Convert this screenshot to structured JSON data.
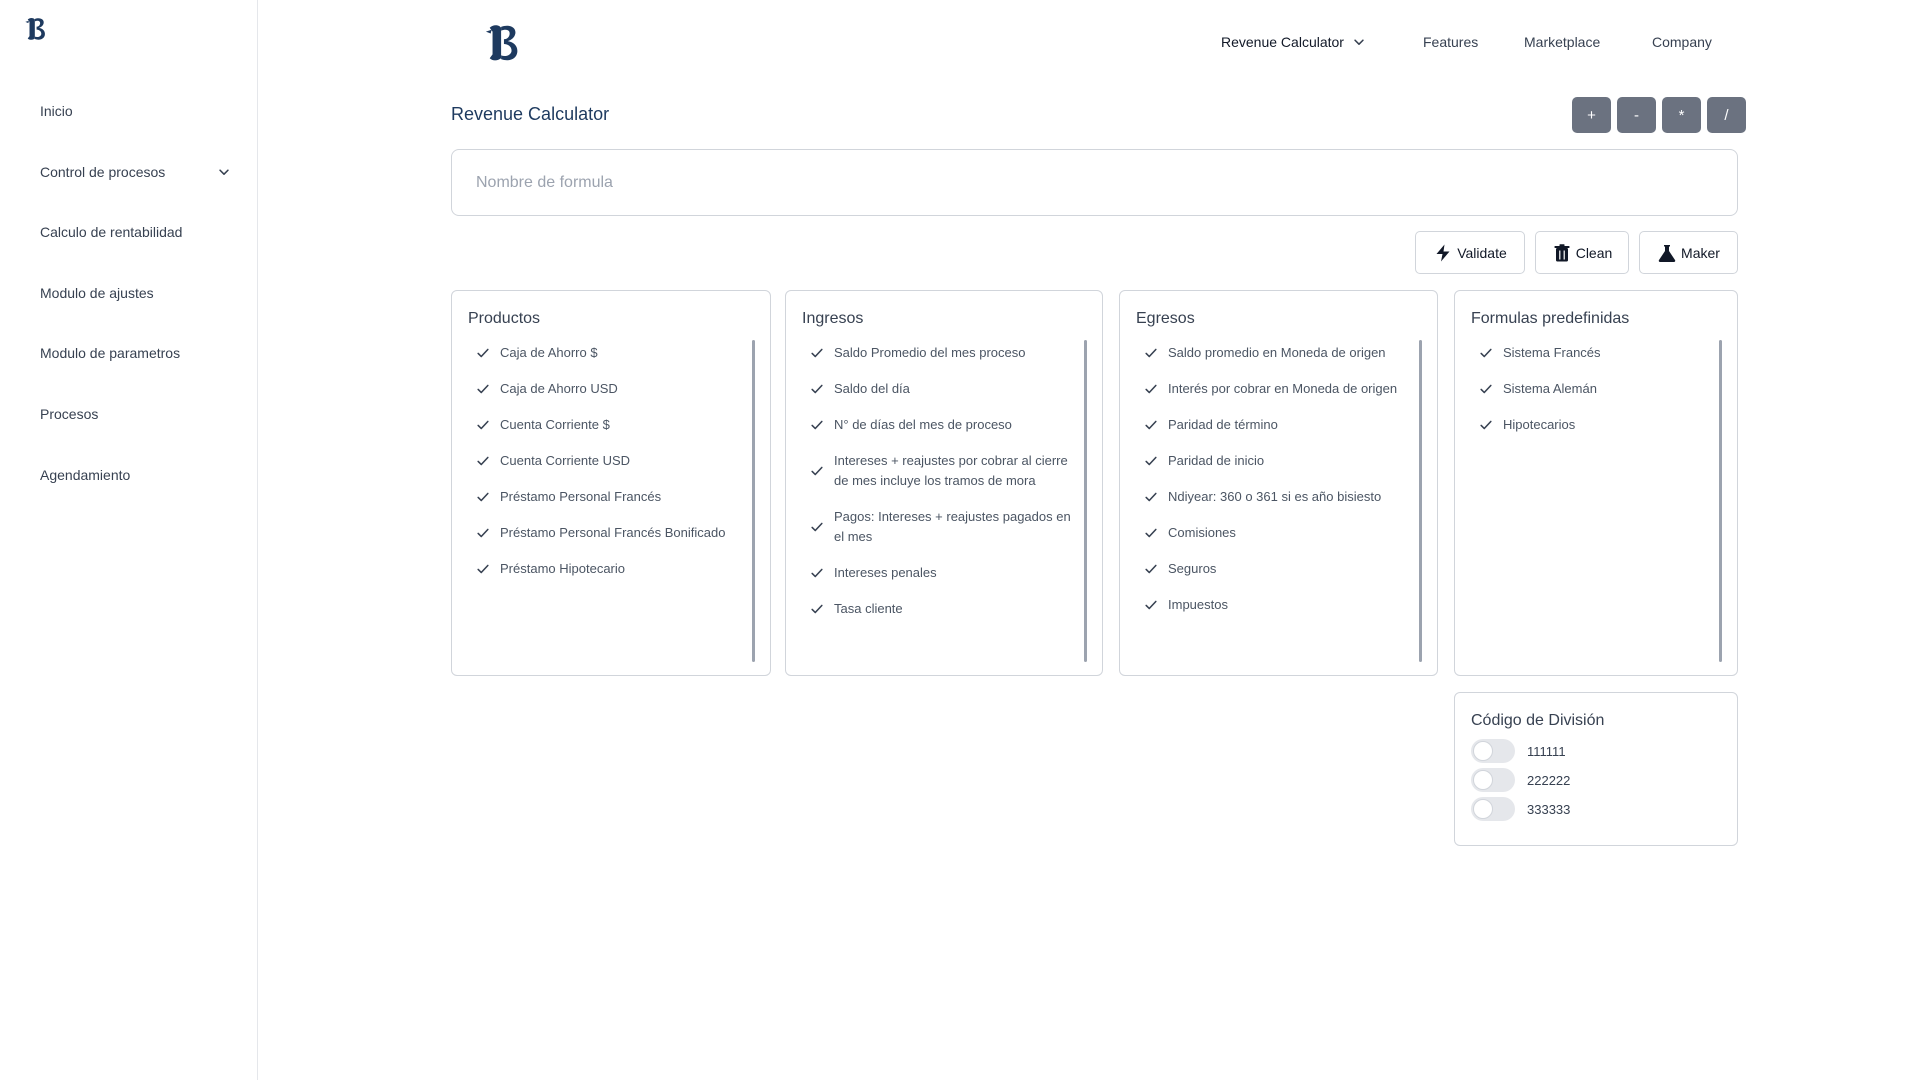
{
  "sidebar": {
    "logo_icon": "gothic-b-logo",
    "items": [
      {
        "label": "Inicio"
      },
      {
        "label": "Control de procesos",
        "icon": "chevron-down-icon"
      },
      {
        "label": "Calculo de rentabilidad"
      },
      {
        "label": "Modulo de ajustes"
      },
      {
        "label": "Modulo de parametros"
      },
      {
        "label": "Procesos"
      },
      {
        "label": "Agendamiento"
      }
    ]
  },
  "topnav": {
    "logo_icon": "gothic-b-logo",
    "items": [
      {
        "label": "Revenue Calculator",
        "icon": "chevron-down-icon"
      },
      {
        "label": "Features"
      },
      {
        "label": "Marketplace"
      },
      {
        "label": "Company"
      }
    ]
  },
  "page": {
    "title": "Revenue Calculator",
    "operators": [
      "+",
      "-",
      "*",
      "/"
    ],
    "formula_placeholder": "Nombre de formula",
    "actions": {
      "validate": "Validate",
      "clean": "Clean",
      "maker": "Maker"
    }
  },
  "panels": {
    "productos": {
      "title": "Productos",
      "items": [
        "Caja de Ahorro $",
        "Caja de Ahorro USD",
        "Cuenta Corriente $",
        "Cuenta Corriente USD",
        "Préstamo Personal Francés",
        "Préstamo Personal Francés Bonificado",
        "Préstamo Hipotecario"
      ]
    },
    "ingresos": {
      "title": "Ingresos",
      "items": [
        "Saldo Promedio del mes proceso",
        "Saldo del día",
        "N° de días del mes de proceso",
        "Intereses + reajustes por cobrar al cierre de mes incluye los tramos de mora",
        "Pagos: Intereses + reajustes pagados en el mes",
        "Intereses penales",
        "Tasa cliente"
      ]
    },
    "egresos": {
      "title": "Egresos",
      "items": [
        "Saldo promedio en Moneda de origen",
        "Interés por cobrar en Moneda de origen",
        "Paridad de término",
        "Paridad de inicio",
        "Ndiyear: 360 o 361 si es año bisiesto",
        "Comisiones",
        "Seguros",
        "Impuestos"
      ]
    },
    "formulas": {
      "title": "Formulas predefinidas",
      "items": [
        "Sistema Francés",
        "Sistema Alemán",
        "Hipotecarios"
      ]
    }
  },
  "division": {
    "title": "Código de División",
    "codes": [
      {
        "code": "111111",
        "enabled": false
      },
      {
        "code": "222222",
        "enabled": false
      },
      {
        "code": "333333",
        "enabled": false
      }
    ]
  }
}
